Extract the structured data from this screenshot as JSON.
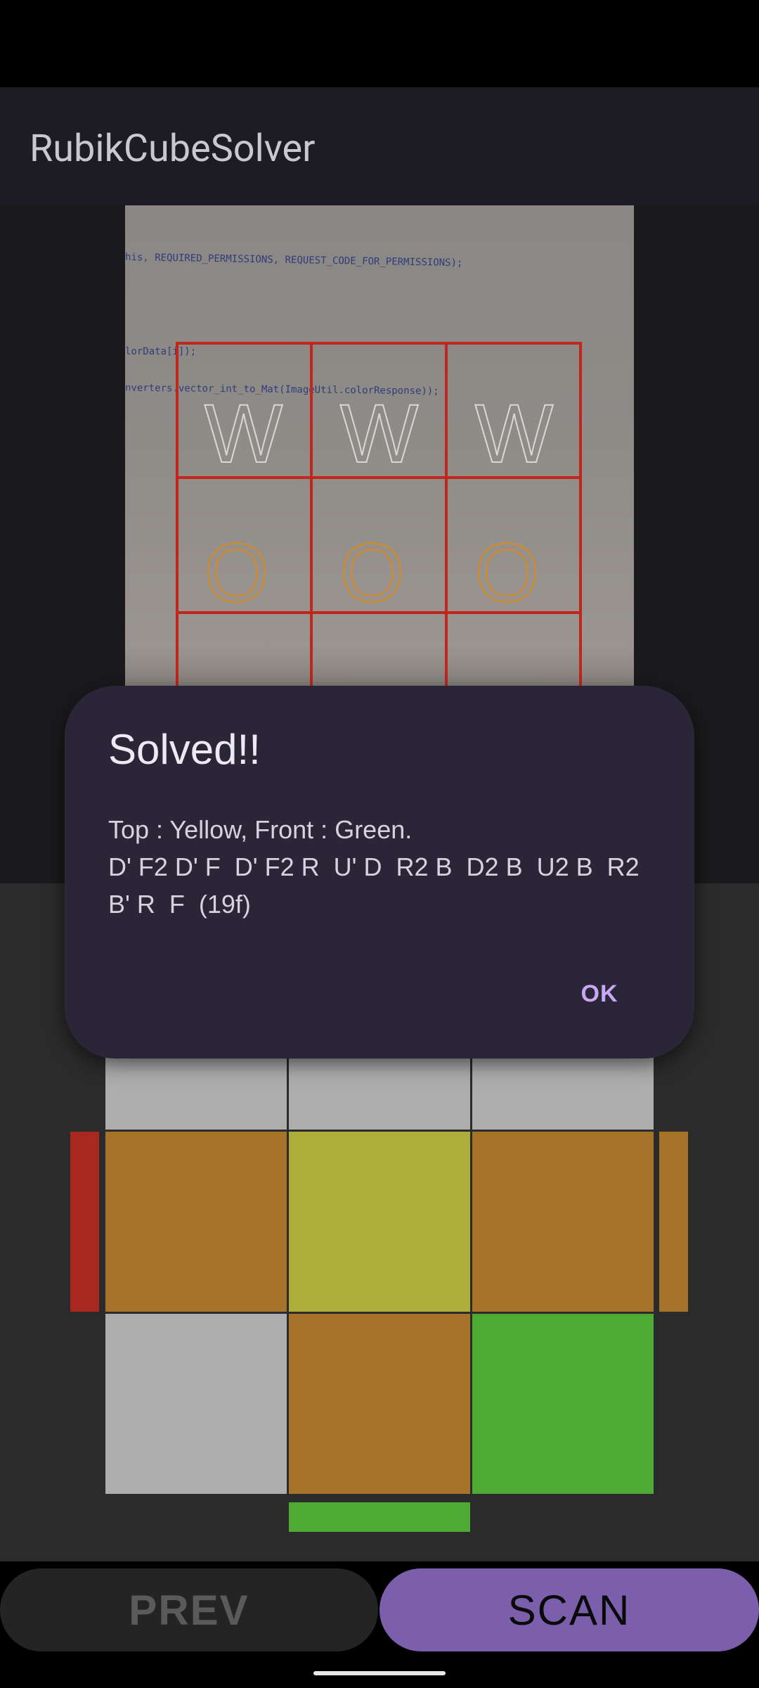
{
  "app": {
    "title": "RubikCubeSolver"
  },
  "camera": {
    "code_lines": [
      "his, REQUIRED_PERMISSIONS, REQUEST_CODE_FOR_PERMISSIONS);",
      "lorData[i]);",
      "nverters.vector_int_to_Mat(ImageUtil.colorResponse));"
    ],
    "detected_labels": [
      "W",
      "W",
      "W",
      "O",
      "O",
      "O"
    ],
    "grid_color": "#c0261e",
    "white_label_color": "#d8d8d8",
    "orange_label_color": "#d88a1e"
  },
  "cube_face": {
    "colors": {
      "white": "#adadad",
      "orange": "#a67328",
      "yellow": "#aeae3c",
      "green": "#4eaa34",
      "red": "#a8271e"
    }
  },
  "buttons": {
    "prev_label": "PREV",
    "scan_label": "SCAN"
  },
  "dialog": {
    "title": "Solved!!",
    "message": "Top : Yellow, Front : Green.\nD' F2 D' F  D' F2 R  U' D  R2 B  D2 B  U2 B  R2\nB' R  F  (19f)",
    "ok_label": "OK"
  }
}
